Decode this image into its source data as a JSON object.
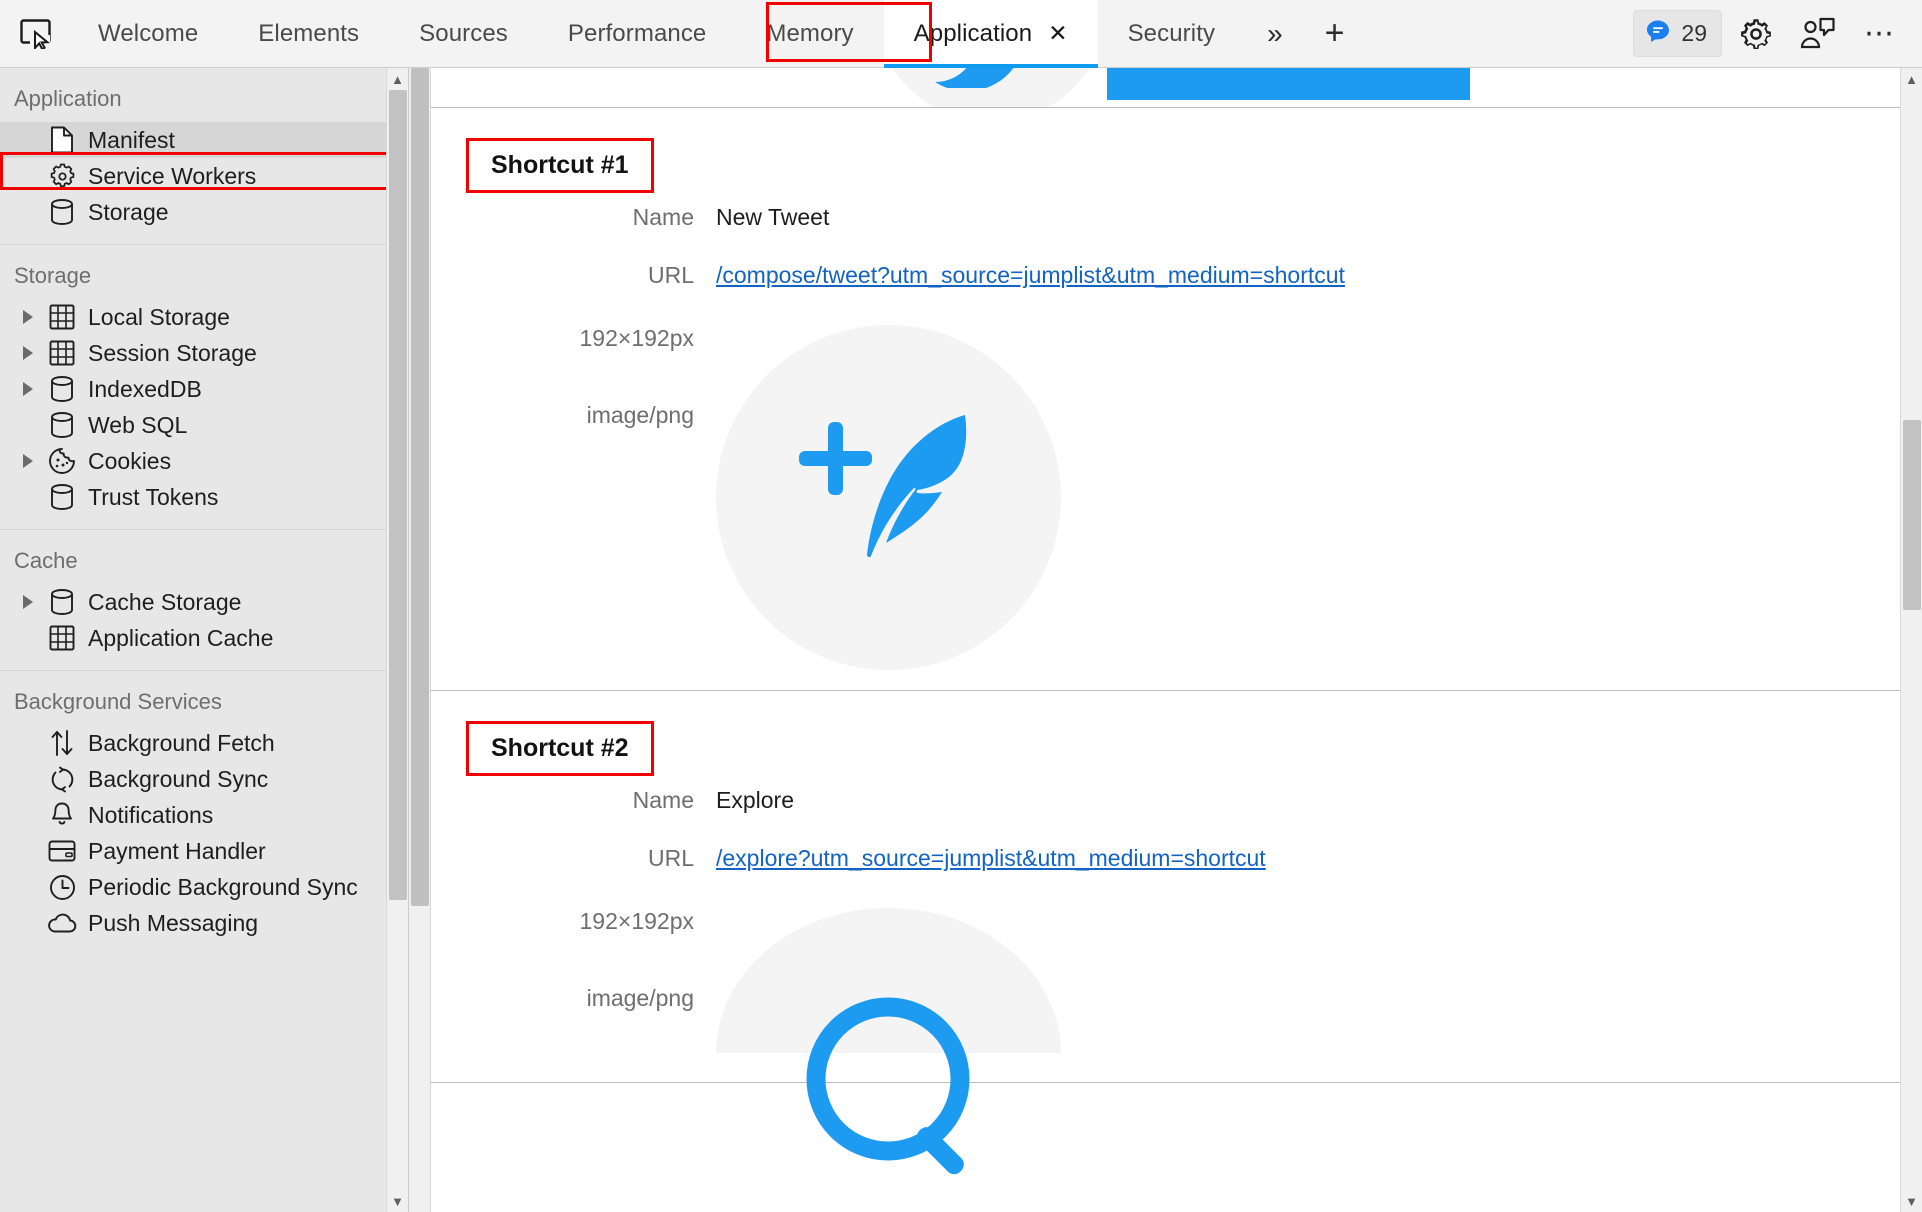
{
  "toolbar": {
    "inspect_icon": "inspect-element-icon",
    "tabs": [
      {
        "label": "Welcome",
        "active": false,
        "closable": false
      },
      {
        "label": "Elements",
        "active": false,
        "closable": false
      },
      {
        "label": "Sources",
        "active": false,
        "closable": false
      },
      {
        "label": "Performance",
        "active": false,
        "closable": false
      },
      {
        "label": "Memory",
        "active": false,
        "closable": false
      },
      {
        "label": "Application",
        "active": true,
        "closable": true
      },
      {
        "label": "Security",
        "active": false,
        "closable": false
      }
    ],
    "close_glyph": "✕",
    "more_tabs_glyph": "»",
    "new_tab_glyph": "+",
    "issues_count": "29",
    "issues_icon": "issues-message-icon",
    "settings_icon": "gear-icon",
    "feedback_icon": "feedback-person-icon",
    "more_icon": "more-options-icon",
    "accent_color": "#0f9bf0",
    "highlight_color": "#f10000"
  },
  "sidebar": {
    "sections": [
      {
        "title": "Application",
        "items": [
          {
            "label": "Manifest",
            "icon": "document-icon",
            "expandable": false,
            "selected": true,
            "highlighted": true
          },
          {
            "label": "Service Workers",
            "icon": "gear-icon",
            "expandable": false,
            "selected": false,
            "highlighted": false
          },
          {
            "label": "Storage",
            "icon": "database-icon",
            "expandable": false,
            "selected": false,
            "highlighted": false
          }
        ]
      },
      {
        "title": "Storage",
        "items": [
          {
            "label": "Local Storage",
            "icon": "table-grid-icon",
            "expandable": true,
            "selected": false,
            "highlighted": false
          },
          {
            "label": "Session Storage",
            "icon": "table-grid-icon",
            "expandable": true,
            "selected": false,
            "highlighted": false
          },
          {
            "label": "IndexedDB",
            "icon": "database-icon",
            "expandable": true,
            "selected": false,
            "highlighted": false
          },
          {
            "label": "Web SQL",
            "icon": "database-icon",
            "expandable": false,
            "selected": false,
            "highlighted": false
          },
          {
            "label": "Cookies",
            "icon": "cookie-icon",
            "expandable": true,
            "selected": false,
            "highlighted": false
          },
          {
            "label": "Trust Tokens",
            "icon": "database-icon",
            "expandable": false,
            "selected": false,
            "highlighted": false
          }
        ]
      },
      {
        "title": "Cache",
        "items": [
          {
            "label": "Cache Storage",
            "icon": "database-icon",
            "expandable": true,
            "selected": false,
            "highlighted": false
          },
          {
            "label": "Application Cache",
            "icon": "table-grid-icon",
            "expandable": false,
            "selected": false,
            "highlighted": false
          }
        ]
      },
      {
        "title": "Background Services",
        "items": [
          {
            "label": "Background Fetch",
            "icon": "up-down-arrows-icon",
            "expandable": false,
            "selected": false,
            "highlighted": false
          },
          {
            "label": "Background Sync",
            "icon": "sync-circular-arrows-icon",
            "expandable": false,
            "selected": false,
            "highlighted": false
          },
          {
            "label": "Notifications",
            "icon": "bell-icon",
            "expandable": false,
            "selected": false,
            "highlighted": false
          },
          {
            "label": "Payment Handler",
            "icon": "credit-card-icon",
            "expandable": false,
            "selected": false,
            "highlighted": false
          },
          {
            "label": "Periodic Background Sync",
            "icon": "clock-icon",
            "expandable": false,
            "selected": false,
            "highlighted": false
          },
          {
            "label": "Push Messaging",
            "icon": "cloud-icon",
            "expandable": false,
            "selected": false,
            "highlighted": false
          }
        ]
      }
    ]
  },
  "main": {
    "field_labels": {
      "name": "Name",
      "url": "URL"
    },
    "shortcuts": [
      {
        "title": "Shortcut #1",
        "name": "New Tweet",
        "url": "/compose/tweet?utm_source=jumplist&utm_medium=shortcut",
        "image_size": "192×192px",
        "image_type": "image/png",
        "icon": "twitter-compose-feather-plus-icon",
        "icon_color": "#1d9bf0"
      },
      {
        "title": "Shortcut #2",
        "name": "Explore",
        "url": "/explore?utm_source=jumplist&utm_medium=shortcut",
        "image_size": "192×192px",
        "image_type": "image/png",
        "icon": "twitter-explore-hashtag-icon",
        "icon_color": "#1d9bf0"
      }
    ]
  }
}
